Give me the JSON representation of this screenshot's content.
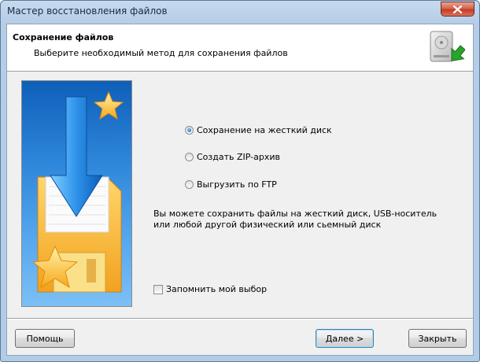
{
  "window": {
    "title": "Мастер восстановления файлов"
  },
  "header": {
    "title": "Сохранение файлов",
    "subtitle": "Выберите необходимый метод для сохранения файлов"
  },
  "options": [
    {
      "label": "Сохранение на жесткий диск",
      "selected": true
    },
    {
      "label": "Создать ZIP-архив",
      "selected": false
    },
    {
      "label": "Выгрузить по FTP",
      "selected": false
    }
  ],
  "description": "Вы можете сохранить файлы на жесткий диск, USB-носитель или любой другой физический или сьемный диск",
  "remember": {
    "label": "Запомнить мой выбор",
    "checked": false
  },
  "buttons": {
    "help": "Помощь",
    "next": "Далее >",
    "close": "Закрыть"
  },
  "icons": {
    "close": "close-x-icon",
    "header": "hard-drive-save-icon",
    "banner": "floppy-download-arrow-icon"
  }
}
